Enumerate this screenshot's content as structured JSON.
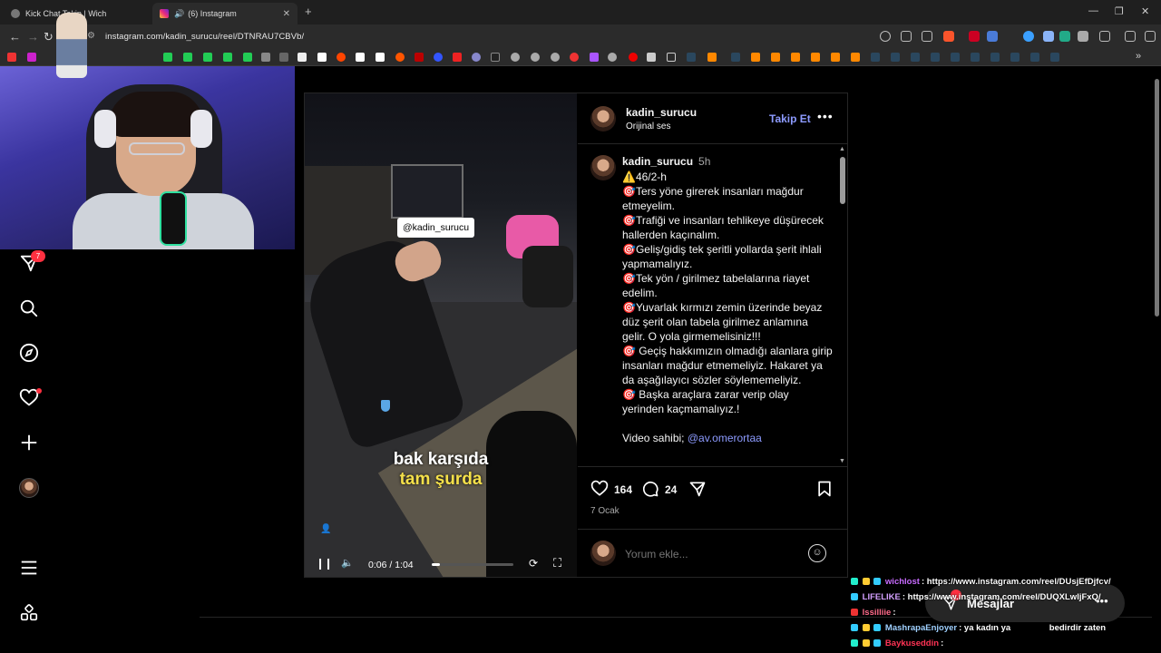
{
  "browser": {
    "tabs": [
      {
        "label": "Kick Chat Takip | Wich",
        "active": false
      },
      {
        "label": "(6) Instagram",
        "active": true
      }
    ],
    "url": "instagram.com/kadin_surucu/reel/DTNRAU7CBVb/"
  },
  "sidebar": {
    "notification_badge": "7"
  },
  "post": {
    "video": {
      "mention_tag": "@kadin_surucu",
      "caption_line1": "bak karşıda",
      "caption_line2": "tam şurda",
      "time": "0:06 / 1:04",
      "progress": 0.1
    },
    "header": {
      "username": "kadin_surucu",
      "audio": "Orijinal ses",
      "follow_label": "Takip Et"
    },
    "caption": {
      "username": "kadin_surucu",
      "time": "5h",
      "lines": [
        "⚠️46/2-h",
        "🎯Ters yöne girerek insanları mağdur etmeyelim.",
        "🎯Trafiği ve insanları tehlikeye düşürecek hallerden kaçınalım.",
        "🎯Geliş/gidiş tek şeritli yollarda şerit ihlali yapmamalıyız.",
        "🎯Tek yön / girilmez tabelalarına riayet edelim.",
        "🎯Yuvarlak kırmızı zemin üzerinde beyaz düz şerit olan tabela girilmez anlamına gelir. O yola girmemelisiniz!!!",
        "🎯 Geçiş hakkımızın olmadığı alanlara girip insanları mağdur etmemeliyiz. Hakaret ya da aşağılayıcı sözler söylememeliyiz.",
        "🎯 Başka araçlara zarar verip olay yerinden kaçmamalıyız.!"
      ],
      "credit_prefix": "Video sahibi; ",
      "credit_link": "@av.omerortaa"
    },
    "likes": "164",
    "comments": "24",
    "date": "7 Ocak",
    "comment_placeholder": "Yorum ekle..."
  },
  "chat": [
    {
      "user": "wichlost",
      "text": ": https://www.instagram.com/reel/DUsjEfDjfcv/",
      "color": "#c86bff"
    },
    {
      "user": "LIFELIKE",
      "text": ": https://www.instagram.com/reel/DUQXLwljFxQ/",
      "color": "#d4a0ff"
    },
    {
      "user": "lssilliie",
      "text": ":",
      "color": "#ff6b8a"
    },
    {
      "user": "MashrapaEnjoyer",
      "text": ": ya kadın ya",
      "color": "#9fd0ff",
      "tail": "bedirdir zaten"
    },
    {
      "user": "Baykuseddin",
      "text": ":",
      "color": "#ff3355"
    }
  ],
  "messages": {
    "label": "Mesajlar"
  }
}
